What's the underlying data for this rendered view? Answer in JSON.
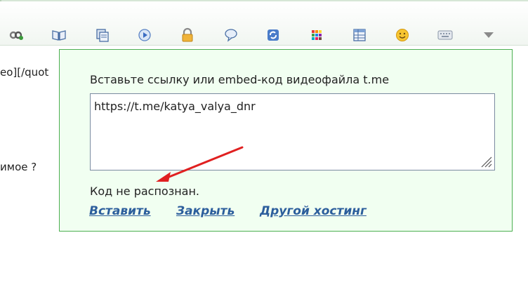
{
  "editor": {
    "line1": "eo][/quot",
    "line2": "имое ?"
  },
  "toolbar": {
    "icons": [
      "link-icon",
      "book-icon",
      "copy-icon",
      "play-icon",
      "lock-icon",
      "comment-icon",
      "refresh-icon",
      "grid-icon",
      "table-icon",
      "smiley-icon",
      "keyboard-icon",
      "dropdown-arrow-icon"
    ]
  },
  "popup": {
    "title": "Вставьте ссылку или embed-код видеофайла t.me",
    "input_value": "https://t.me/katya_valya_dnr",
    "status": "Код не распознан.",
    "insert_label": "Вставить",
    "close_label": "Закрыть",
    "other_label": "Другой хостинг"
  },
  "colors": {
    "popup_bg": "#f1fff1",
    "popup_border": "#4caf50",
    "link": "#2c5e9c",
    "annotation_arrow": "#e02020"
  }
}
